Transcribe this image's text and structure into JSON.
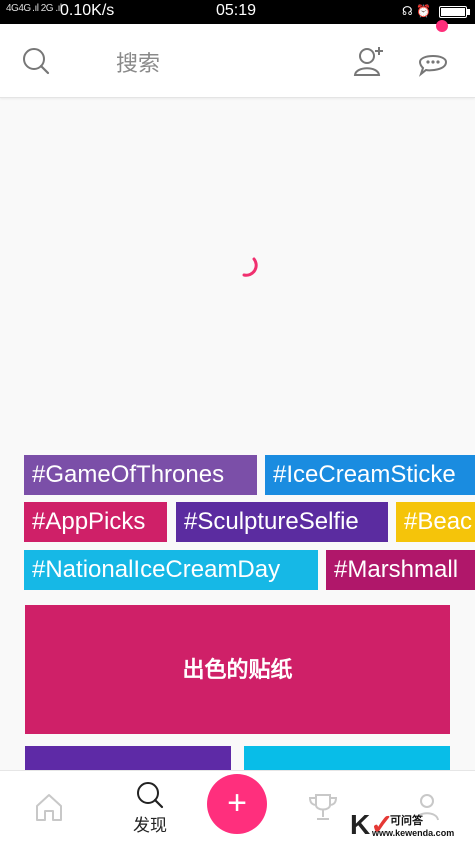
{
  "status_bar": {
    "network": "4G4G .ıl  2G .ıl",
    "speed": "0.10K/s",
    "time": "05:19",
    "icons": [
      "headset-icon",
      "alarm-icon",
      "battery-icon"
    ]
  },
  "header": {
    "search_label": "搜索",
    "icons": [
      "search-icon",
      "add-user-icon",
      "chat-icon"
    ],
    "notification_dot_color": "#ff2e7a"
  },
  "tags": [
    {
      "label": "#GameOfThrones",
      "color": "#7b4fa8"
    },
    {
      "label": "#IceCreamSticke",
      "color": "#1a8ce0"
    },
    {
      "label": "#AppPicks",
      "color": "#cf2068"
    },
    {
      "label": "#SculptureSelfie",
      "color": "#5b2ca0"
    },
    {
      "label": "#Beac",
      "color": "#f5c40a"
    },
    {
      "label": "#NationalIceCreamDay",
      "color": "#16b8e6"
    },
    {
      "label": "#Marshmall",
      "color": "#b0176a"
    }
  ],
  "featured_card": {
    "title": "出色的贴纸",
    "color": "#cf2068"
  },
  "bottom_nav": {
    "discover_label": "发现",
    "fab_label": "+",
    "fab_color": "#ff2f7d"
  },
  "watermark": {
    "brand": "K",
    "name": "可问答",
    "url": "www.kewenda.com"
  }
}
